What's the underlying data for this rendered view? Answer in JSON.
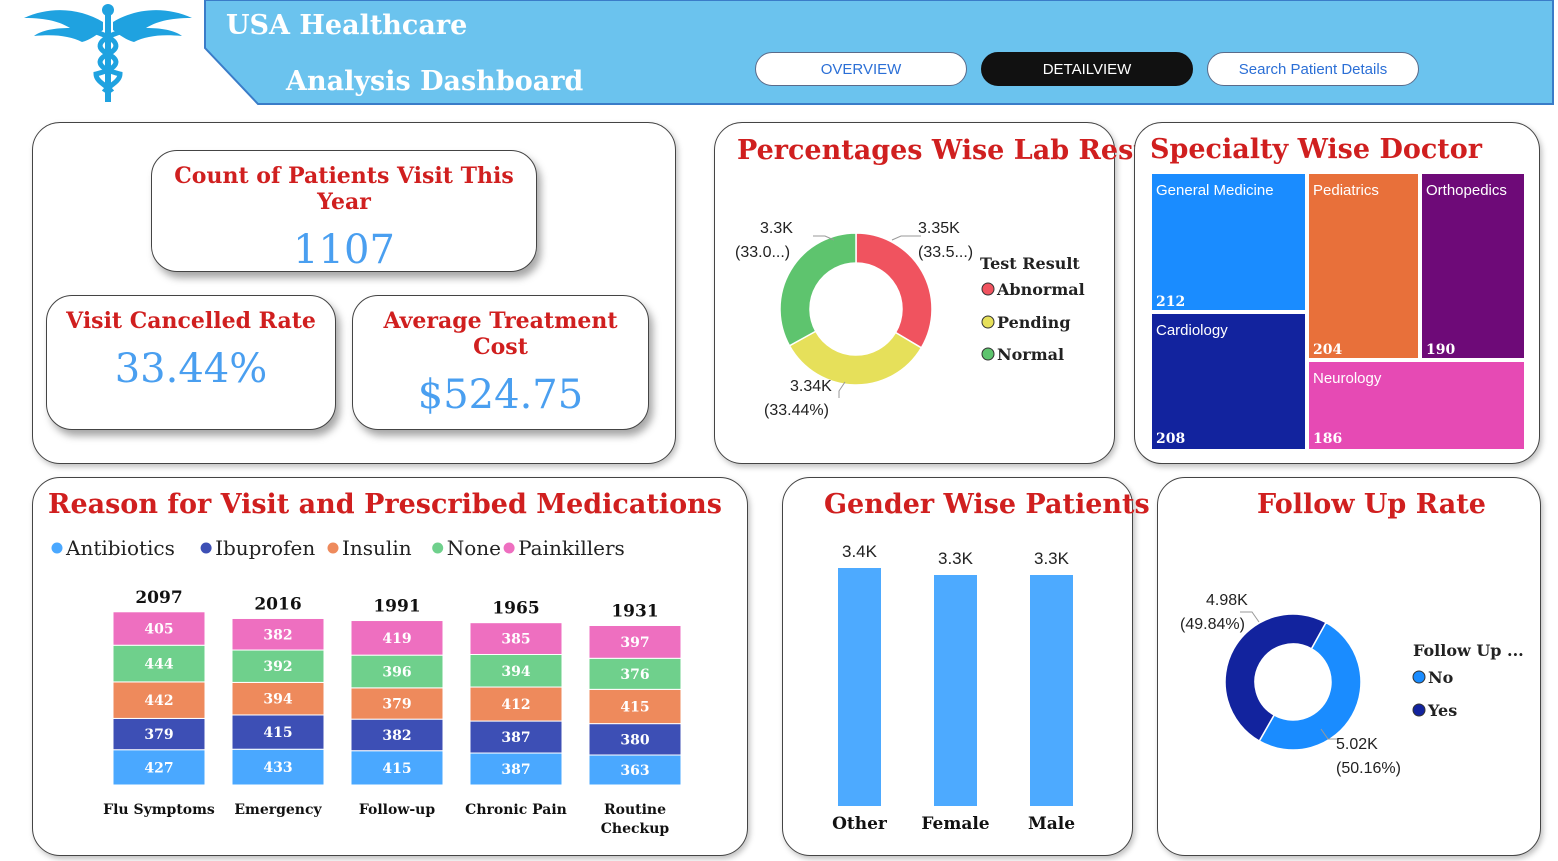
{
  "header": {
    "title_line1": "USA Healthcare",
    "title_line2": "Analysis Dashboard",
    "nav": [
      {
        "label": "OVERVIEW",
        "active": false
      },
      {
        "label": "DETAILVIEW",
        "active": true
      },
      {
        "label": "Search Patient Details",
        "active": false
      }
    ],
    "logo_icon": "caduceus-icon",
    "colors": {
      "banner": "#6bc3ee",
      "banner_border": "#3a7cc8",
      "logo": "#1fa2e0"
    }
  },
  "kpis": {
    "patients_visit": {
      "label": "Count of Patients Visit This Year",
      "value": "1107"
    },
    "cancel_rate": {
      "label": "Visit Cancelled Rate",
      "value": "33.44%"
    },
    "avg_cost": {
      "label": "Average Treatment Cost",
      "value": "$524.75"
    }
  },
  "lab_result": {
    "title": "Percentages Wise Lab Result",
    "legend_title": "Test Result",
    "legend": [
      "Abnormal",
      "Pending",
      "Normal"
    ],
    "labels": {
      "abnormal": [
        "3.35K",
        "(33.5...)"
      ],
      "pending": [
        "3.34K",
        "(33.44%)"
      ],
      "normal": [
        "3.3K",
        "(33.0...)"
      ]
    }
  },
  "specialty": {
    "title": "Specialty Wise Doctor",
    "tiles": [
      {
        "name": "General Medicine",
        "value": "212",
        "color": "#1a8cff"
      },
      {
        "name": "Pediatrics",
        "value": "204",
        "color": "#e8703a"
      },
      {
        "name": "Orthopedics",
        "value": "190",
        "color": "#6e0a78"
      },
      {
        "name": "Cardiology",
        "value": "208",
        "color": "#12239e"
      },
      {
        "name": "Neurology",
        "value": "186",
        "color": "#e64ab4"
      }
    ]
  },
  "reason_meds": {
    "title": "Reason for Visit and Prescribed Medications",
    "legend": [
      {
        "name": "Antibiotics",
        "color": "#4aa8ff"
      },
      {
        "name": "Ibuprofen",
        "color": "#3d4fb5"
      },
      {
        "name": "Insulin",
        "color": "#ee8a5c"
      },
      {
        "name": "None",
        "color": "#6fd08c"
      },
      {
        "name": "Painkillers",
        "color": "#ee6fc0"
      }
    ],
    "totals": [
      "2097",
      "2016",
      "1991",
      "1965",
      "1931"
    ],
    "category_lines": [
      [
        "Flu Symptoms"
      ],
      [
        "Emergency"
      ],
      [
        "Follow-up"
      ],
      [
        "Chronic Pain"
      ],
      [
        "Routine",
        "Checkup"
      ]
    ]
  },
  "gender": {
    "title": "Gender Wise Patients",
    "bar_color": "#4daaff",
    "value_labels": [
      "3.4K",
      "3.3K",
      "3.3K"
    ]
  },
  "follow_up": {
    "title": "Follow Up Rate",
    "legend_title": "Follow Up ...",
    "legend": [
      "No",
      "Yes"
    ],
    "labels": {
      "no": [
        "5.02K",
        "(50.16%)"
      ],
      "yes": [
        "4.98K",
        "(49.84%)"
      ]
    }
  },
  "chart_data": [
    {
      "type": "pie",
      "chart": "lab_result",
      "categories": [
        "Abnormal",
        "Pending",
        "Normal"
      ],
      "values": [
        3350,
        3340,
        3300
      ],
      "colors": [
        "#f0535f",
        "#e6e05a",
        "#5ec46e"
      ]
    },
    {
      "type": "bar",
      "stacked": true,
      "chart": "reason_meds",
      "categories": [
        "Flu Symptoms",
        "Emergency",
        "Follow-up",
        "Chronic Pain",
        "Routine Checkup"
      ],
      "series": [
        {
          "name": "Antibiotics",
          "values": [
            427,
            433,
            415,
            387,
            363
          ]
        },
        {
          "name": "Ibuprofen",
          "values": [
            379,
            415,
            382,
            387,
            380
          ]
        },
        {
          "name": "Insulin",
          "values": [
            442,
            394,
            379,
            412,
            415
          ]
        },
        {
          "name": "None",
          "values": [
            444,
            392,
            396,
            394,
            376
          ]
        },
        {
          "name": "Painkillers",
          "values": [
            405,
            382,
            419,
            385,
            397
          ]
        }
      ]
    },
    {
      "type": "bar",
      "chart": "gender",
      "categories": [
        "Other",
        "Female",
        "Male"
      ],
      "values": [
        3400,
        3300,
        3300
      ],
      "ylim": [
        0,
        3400
      ]
    },
    {
      "type": "pie",
      "chart": "follow_up",
      "categories": [
        "No",
        "Yes"
      ],
      "values": [
        5020,
        4980
      ],
      "colors": [
        "#1a8cff",
        "#12239e"
      ]
    }
  ]
}
